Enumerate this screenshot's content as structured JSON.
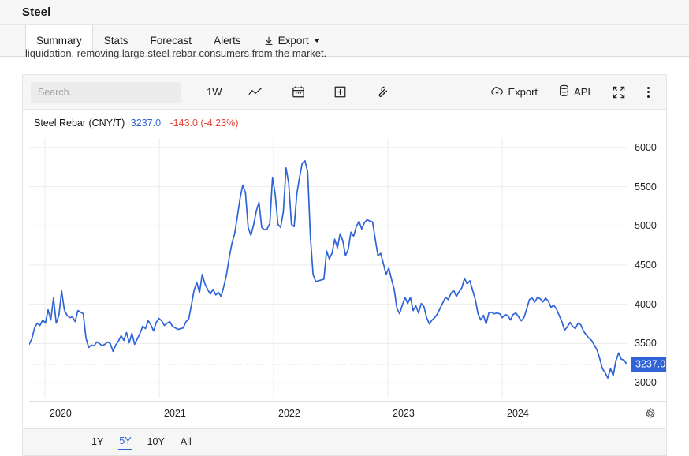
{
  "header": {
    "title": "Steel"
  },
  "tabs": [
    {
      "label": "Summary",
      "active": true,
      "icon": null
    },
    {
      "label": "Stats",
      "active": false,
      "icon": null
    },
    {
      "label": "Forecast",
      "active": false,
      "icon": null
    },
    {
      "label": "Alerts",
      "active": false,
      "icon": null
    },
    {
      "label": "Export",
      "active": false,
      "icon": "download-icon",
      "caret": true
    }
  ],
  "body_text": "liquidation, removing large steel rebar consumers from the market.",
  "toolbar": {
    "search_placeholder": "Search...",
    "search_value": "",
    "interval_label": "1W",
    "line_chart_icon": "line-chart-icon",
    "calendar_icon": "calendar-icon",
    "add_icon": "plus-box-icon",
    "tools_icon": "wrench-icon",
    "export_label": "Export",
    "export_icon": "cloud-download-icon",
    "api_label": "API",
    "api_icon": "database-icon",
    "fullscreen_icon": "expand-icon",
    "menu_icon": "kebab-menu-icon"
  },
  "chart_header": {
    "series_name": "Steel Rebar (CNY/T)",
    "last_price": "3237.0",
    "change": "-143.0 (-4.23%)",
    "price_color": "#2f63d8",
    "change_color": "#e2473b"
  },
  "settings_icon": "gear-icon",
  "range_selector": {
    "options": [
      {
        "label": "1Y",
        "active": false
      },
      {
        "label": "5Y",
        "active": true
      },
      {
        "label": "10Y",
        "active": false
      },
      {
        "label": "All",
        "active": false
      }
    ]
  },
  "chart_data": {
    "type": "line",
    "title": "Steel Rebar (CNY/T)",
    "xlabel": "",
    "ylabel": "CNY/T",
    "ylim": [
      2800,
      6120
    ],
    "yticks": [
      6000,
      5500,
      5000,
      4500,
      4000,
      3500,
      3000
    ],
    "xticks": [
      "2020",
      "2021",
      "2022",
      "2023",
      "2024"
    ],
    "xlim": [
      "2019-10",
      "2024-12"
    ],
    "grid": true,
    "legend": "none",
    "line_color": "#2f63d8",
    "marker_line": {
      "value": 3237.0,
      "style": "dotted",
      "color": "#2f63d8",
      "label": "3237.0"
    },
    "series": [
      {
        "name": "Steel Rebar",
        "values": [
          3490,
          3560,
          3700,
          3760,
          3730,
          3800,
          3760,
          3930,
          3800,
          4080,
          3760,
          3860,
          4170,
          3930,
          3860,
          3830,
          3840,
          3780,
          3920,
          3900,
          3880,
          3570,
          3450,
          3480,
          3470,
          3520,
          3500,
          3470,
          3490,
          3520,
          3500,
          3400,
          3480,
          3530,
          3600,
          3540,
          3640,
          3510,
          3630,
          3490,
          3560,
          3630,
          3720,
          3690,
          3790,
          3740,
          3660,
          3770,
          3820,
          3790,
          3730,
          3760,
          3780,
          3720,
          3700,
          3680,
          3690,
          3700,
          3780,
          3810,
          3990,
          4180,
          4280,
          4150,
          4380,
          4260,
          4190,
          4130,
          4190,
          4120,
          4150,
          4100,
          4230,
          4380,
          4600,
          4780,
          4900,
          5120,
          5350,
          5520,
          5420,
          4980,
          4880,
          5010,
          5190,
          5300,
          4980,
          4950,
          4960,
          5030,
          5620,
          5400,
          5020,
          4980,
          5180,
          5740,
          5540,
          5020,
          4990,
          5410,
          5620,
          5800,
          5830,
          5690,
          4860,
          4380,
          4290,
          4300,
          4310,
          4320,
          4680,
          4580,
          4650,
          4830,
          4720,
          4900,
          4810,
          4620,
          4700,
          4920,
          4870,
          4990,
          5060,
          4960,
          5040,
          5080,
          5060,
          5050,
          4830,
          4620,
          4650,
          4520,
          4380,
          4460,
          4320,
          4190,
          3950,
          3880,
          3990,
          4090,
          4010,
          4090,
          3920,
          3980,
          3890,
          4010,
          3970,
          3830,
          3750,
          3800,
          3830,
          3880,
          3950,
          4020,
          4090,
          4060,
          4140,
          4180,
          4100,
          4160,
          4210,
          4330,
          4260,
          4300,
          4180,
          4060,
          3880,
          3800,
          3860,
          3750,
          3890,
          3900,
          3880,
          3890,
          3880,
          3830,
          3870,
          3860,
          3800,
          3870,
          3890,
          3840,
          3790,
          3830,
          3940,
          4060,
          4080,
          4030,
          4090,
          4070,
          4030,
          4080,
          4040,
          3960,
          3990,
          3940,
          3860,
          3780,
          3670,
          3710,
          3770,
          3720,
          3690,
          3760,
          3740,
          3660,
          3610,
          3570,
          3540,
          3480,
          3420,
          3310,
          3180,
          3130,
          3060,
          3180,
          3090,
          3280,
          3380,
          3300,
          3290,
          3237
        ]
      }
    ]
  }
}
